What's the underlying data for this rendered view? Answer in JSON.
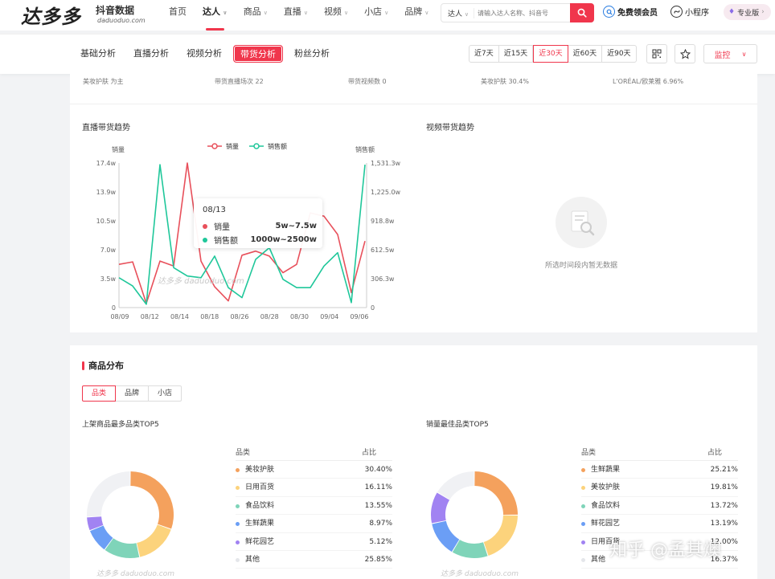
{
  "brand": {
    "logo_text": "达多多",
    "cn": "抖音数据",
    "en": "daduoduo.com"
  },
  "topnav": {
    "items": [
      {
        "label": "首页",
        "caret": false
      },
      {
        "label": "达人",
        "caret": true
      },
      {
        "label": "商品",
        "caret": true
      },
      {
        "label": "直播",
        "caret": true
      },
      {
        "label": "视频",
        "caret": true
      },
      {
        "label": "小店",
        "caret": true
      },
      {
        "label": "品牌",
        "caret": true
      }
    ],
    "active": "达人",
    "search_type": "达人",
    "search_placeholder": "请输入达人名称、抖音号",
    "vip_label": "免费领会员",
    "mini_label": "小程序",
    "pro_label": "专业版"
  },
  "subnav": {
    "tabs": [
      "基础分析",
      "直播分析",
      "视频分析",
      "带货分析",
      "粉丝分析"
    ],
    "active_tab": "带货分析",
    "ranges": [
      "近7天",
      "近15天",
      "近30天",
      "近60天",
      "近90天"
    ],
    "active_range": "近30天",
    "monitor_label": "监控"
  },
  "stats_strip": [
    "美妆护肤 为主",
    "带货直播场次 22",
    "带货视频数 0",
    "美妆护肤 30.4%",
    "L'ORÉAL/欧莱雅 6.96%"
  ],
  "trend": {
    "live_title": "直播带货趋势",
    "video_title": "视频带货趋势",
    "empty_text": "所选时间段内暂无数据",
    "watermark": "达多多 daduoduo.com",
    "tooltip": {
      "date": "08/13",
      "rows": [
        {
          "name": "销量",
          "value": "5w~7.5w",
          "color": "#e8505b"
        },
        {
          "name": "销售额",
          "value": "1000w~2500w",
          "color": "#1fc79a"
        }
      ]
    }
  },
  "chart_data": {
    "type": "line",
    "title": "直播带货趋势",
    "ylabel_left": "销量",
    "ylabel_right": "销售额",
    "legend_position": "top",
    "left_ticks": [
      "0",
      "3.5w",
      "7.0w",
      "10.5w",
      "13.9w",
      "17.4w"
    ],
    "right_ticks": [
      "0",
      "306.3w",
      "612.5w",
      "918.8w",
      "1,225.0w",
      "1,531.3w"
    ],
    "ylim_left": [
      0,
      17.4
    ],
    "ylim_right": [
      0,
      1531.3
    ],
    "x_ticks": [
      "08/09",
      "08/12",
      "08/14",
      "08/18",
      "08/26",
      "08/28",
      "08/30",
      "09/04",
      "09/06"
    ],
    "series": [
      {
        "name": "销量",
        "color": "#e8505b",
        "axis": "left",
        "values": [
          5.2,
          5.5,
          0.5,
          5.6,
          5.0,
          17.4,
          5.6,
          2.5,
          0.8,
          6.3,
          6.8,
          6.2,
          4.2,
          5.2,
          11.4,
          11.0,
          8.8,
          1.8,
          8.0
        ]
      },
      {
        "name": "销售额",
        "color": "#1fc79a",
        "axis": "left_scaled",
        "values": [
          3.6,
          2.6,
          0.4,
          17.2,
          4.8,
          3.8,
          3.6,
          6.2,
          2.4,
          1.2,
          5.8,
          7.2,
          3.4,
          2.4,
          2.4,
          5.0,
          6.6,
          0.6,
          17.2
        ]
      }
    ]
  },
  "goods": {
    "title": "商品分布",
    "tabs": [
      "品类",
      "品牌",
      "小店"
    ],
    "active_tab": "品类",
    "left": {
      "title": "上架商品最多品类TOP5",
      "col_name": "品类",
      "col_pct": "占比",
      "rows": [
        {
          "name": "美妆护肤",
          "pct": "30.40%",
          "value": 30.4,
          "color": "#f4a15d"
        },
        {
          "name": "日用百货",
          "pct": "16.11%",
          "value": 16.11,
          "color": "#fcd37c"
        },
        {
          "name": "食品饮料",
          "pct": "13.55%",
          "value": 13.55,
          "color": "#7fd4b9"
        },
        {
          "name": "生鲜蔬果",
          "pct": "8.97%",
          "value": 8.97,
          "color": "#6b9ef5"
        },
        {
          "name": "鲜花园艺",
          "pct": "5.12%",
          "value": 5.12,
          "color": "#a183f2"
        },
        {
          "name": "其他",
          "pct": "25.85%",
          "value": 25.85,
          "color": "#f0f1f4"
        }
      ]
    },
    "right": {
      "title": "销量最佳品类TOP5",
      "col_name": "品类",
      "col_pct": "占比",
      "rows": [
        {
          "name": "生鲜蔬果",
          "pct": "25.21%",
          "value": 25.21,
          "color": "#f4a15d"
        },
        {
          "name": "美妆护肤",
          "pct": "19.81%",
          "value": 19.81,
          "color": "#fcd37c"
        },
        {
          "name": "食品饮料",
          "pct": "13.72%",
          "value": 13.72,
          "color": "#7fd4b9"
        },
        {
          "name": "鲜花园艺",
          "pct": "13.19%",
          "value": 13.19,
          "color": "#6b9ef5"
        },
        {
          "name": "日用百货",
          "pct": "12.00%",
          "value": 12.0,
          "color": "#a183f2"
        },
        {
          "name": "其他",
          "pct": "16.37%",
          "value": 16.37,
          "color": "#f0f1f4"
        }
      ]
    }
  },
  "overlay_watermark": "知乎 @孟其燠"
}
